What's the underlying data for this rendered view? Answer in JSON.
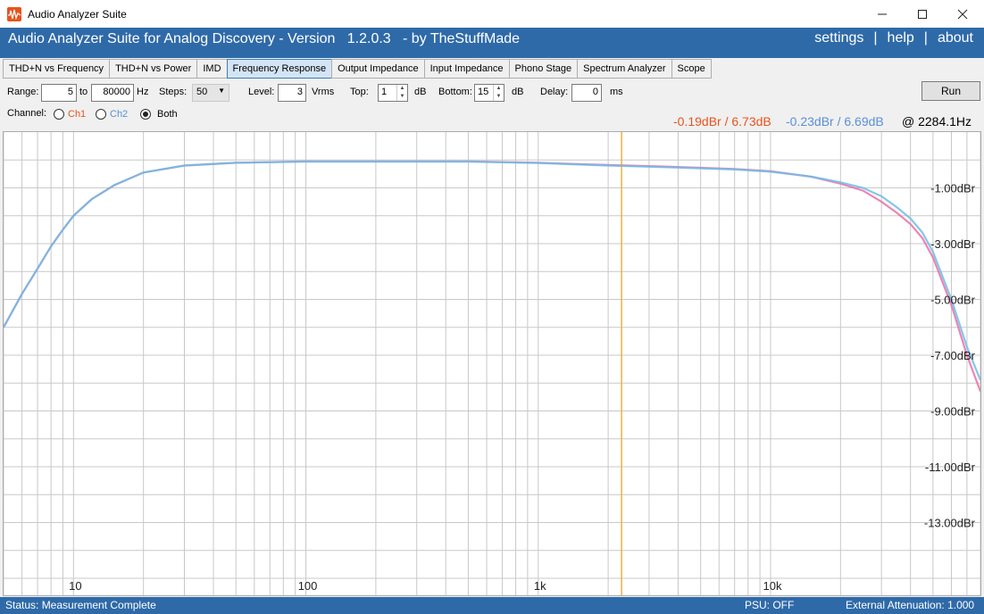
{
  "window": {
    "title": "Audio Analyzer Suite",
    "minimize": "—",
    "maximize": "☐",
    "close": "✕"
  },
  "header": {
    "app_title": "Audio Analyzer Suite for Analog Discovery - Version   1.2.0.3   - by TheStuffMade",
    "links": [
      "settings",
      "help",
      "about"
    ],
    "separator": "|"
  },
  "tabs": [
    {
      "label": "THD+N vs Frequency",
      "active": false
    },
    {
      "label": "THD+N vs Power",
      "active": false
    },
    {
      "label": "IMD",
      "active": false
    },
    {
      "label": "Frequency Response",
      "active": true
    },
    {
      "label": "Output Impedance",
      "active": false
    },
    {
      "label": "Input Impedance",
      "active": false
    },
    {
      "label": "Phono Stage",
      "active": false
    },
    {
      "label": "Spectrum Analyzer",
      "active": false
    },
    {
      "label": "Scope",
      "active": false
    }
  ],
  "controls": {
    "range_label": "Range:",
    "range_from": "5",
    "to_label": "to",
    "range_to": "80000",
    "hz_label": "Hz",
    "steps_label": "Steps:",
    "steps_value": "50",
    "level_label": "Level:",
    "level_value": "3",
    "vrms_label": "Vrms",
    "top_label": "Top:",
    "top_value": "1",
    "db_label": "dB",
    "bottom_label": "Bottom:",
    "bottom_value": "15",
    "db_label2": "dB",
    "delay_label": "Delay:",
    "delay_value": "0",
    "ms_label": "ms",
    "run_label": "Run",
    "channel_label": "Channel:",
    "ch1_label": "Ch1",
    "ch2_label": "Ch2",
    "both_label": "Both",
    "selected_channel": "Both"
  },
  "readout": {
    "ch1": "-0.19dBr / 6.73dB",
    "ch2": "-0.23dBr / 6.69dB",
    "freq": "@ 2284.1Hz",
    "ch1_color": "#e8531c",
    "ch2_color": "#5b8fd6"
  },
  "status": {
    "left": "Status: Measurement Complete",
    "psu": "PSU: OFF",
    "attenuation": "External Attenuation: 1.000"
  },
  "colors": {
    "header_bg": "#2f6aa8",
    "ch1_line": "#ec6fa6",
    "ch2_line": "#6bbde8",
    "overlap_line": "#8a7ac8",
    "cursor": "#f2b13a"
  },
  "chart_data": {
    "type": "line",
    "x_scale": "log",
    "xlim": [
      5,
      80000
    ],
    "ylim": [
      -15,
      1
    ],
    "x_tick_labels": [
      {
        "value": 10,
        "label": "10"
      },
      {
        "value": 100,
        "label": "100"
      },
      {
        "value": 1000,
        "label": "1k"
      },
      {
        "value": 10000,
        "label": "10k"
      }
    ],
    "y_tick_labels": [
      {
        "value": -1,
        "label": "-1.00dBr"
      },
      {
        "value": -3,
        "label": "-3.00dBr"
      },
      {
        "value": -5,
        "label": "-5.00dBr"
      },
      {
        "value": -7,
        "label": "-7.00dBr"
      },
      {
        "value": -9,
        "label": "-9.00dBr"
      },
      {
        "value": -11,
        "label": "-11.00dBr"
      },
      {
        "value": -13,
        "label": "-13.00dBr"
      }
    ],
    "cursor_x": 2284.1,
    "series": [
      {
        "name": "Ch1",
        "x": [
          5,
          6,
          7,
          8,
          9,
          10,
          12,
          15,
          20,
          30,
          50,
          100,
          200,
          500,
          1000,
          2000,
          3000,
          5000,
          7000,
          10000,
          15000,
          20000,
          25000,
          30000,
          35000,
          40000,
          45000,
          50000,
          60000,
          70000,
          80000
        ],
        "y": [
          -6.0,
          -4.8,
          -3.9,
          -3.1,
          -2.5,
          -2.0,
          -1.4,
          -0.9,
          -0.45,
          -0.2,
          -0.1,
          -0.05,
          -0.05,
          -0.05,
          -0.1,
          -0.18,
          -0.22,
          -0.28,
          -0.32,
          -0.4,
          -0.6,
          -0.85,
          -1.1,
          -1.5,
          -1.9,
          -2.3,
          -2.8,
          -3.5,
          -5.2,
          -7.0,
          -8.3
        ]
      },
      {
        "name": "Ch2",
        "x": [
          5,
          6,
          7,
          8,
          9,
          10,
          12,
          15,
          20,
          30,
          50,
          100,
          200,
          500,
          1000,
          2000,
          3000,
          5000,
          7000,
          10000,
          15000,
          20000,
          25000,
          30000,
          35000,
          40000,
          45000,
          50000,
          60000,
          70000,
          80000
        ],
        "y": [
          -6.0,
          -4.8,
          -3.9,
          -3.1,
          -2.5,
          -2.0,
          -1.4,
          -0.9,
          -0.45,
          -0.2,
          -0.1,
          -0.06,
          -0.06,
          -0.06,
          -0.11,
          -0.2,
          -0.24,
          -0.3,
          -0.34,
          -0.42,
          -0.6,
          -0.8,
          -1.0,
          -1.3,
          -1.7,
          -2.1,
          -2.6,
          -3.3,
          -5.0,
          -6.7,
          -7.9
        ]
      }
    ]
  }
}
